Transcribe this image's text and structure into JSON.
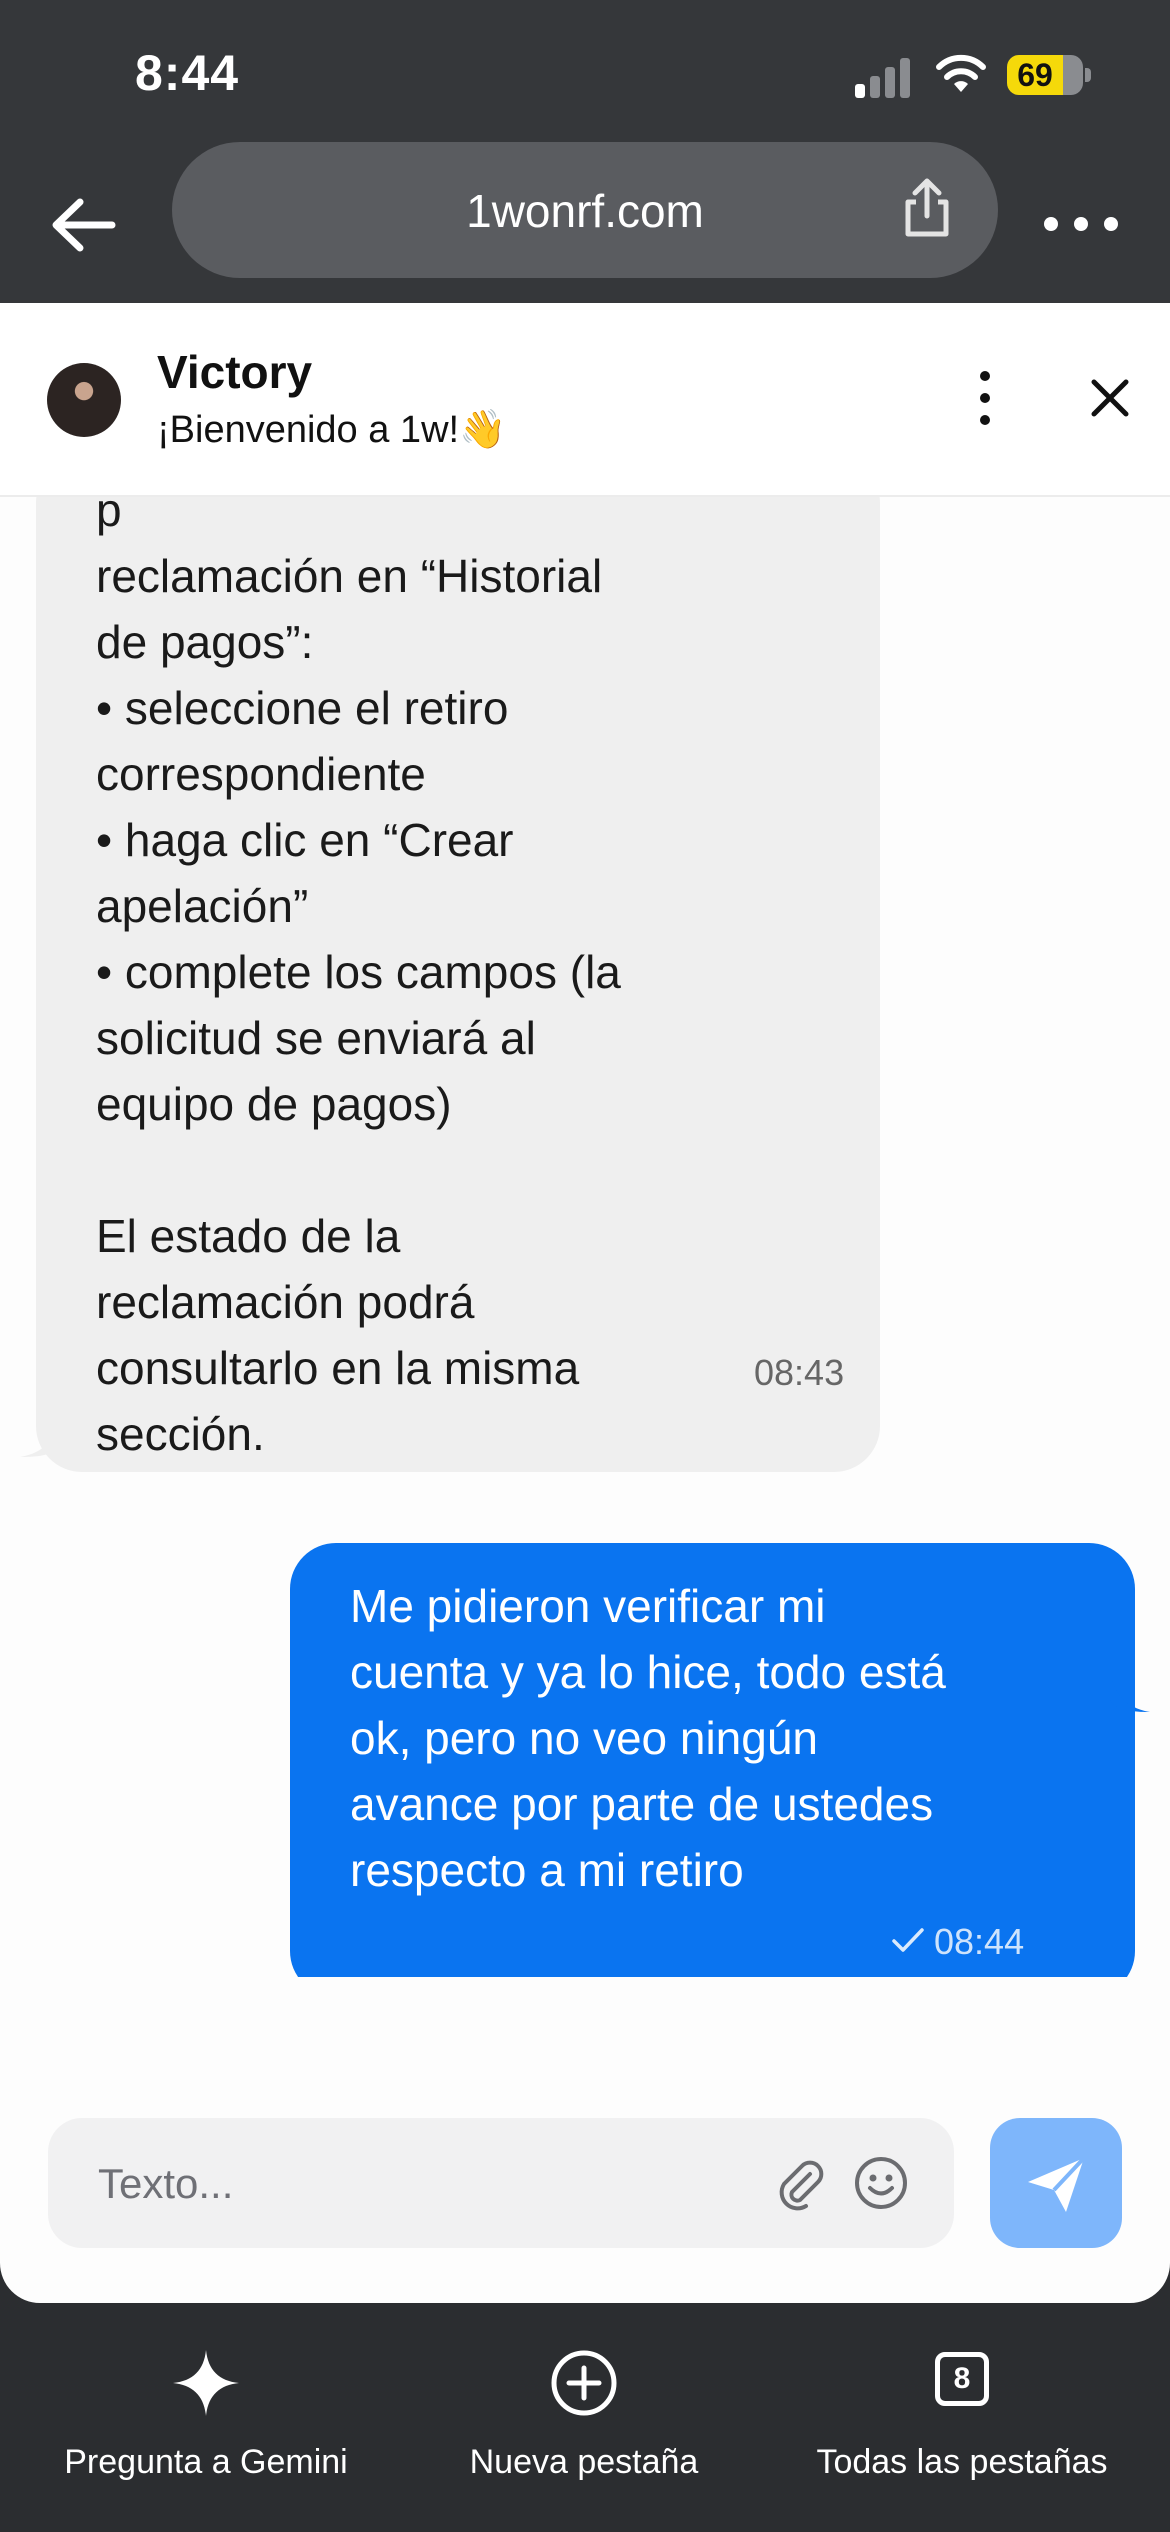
{
  "status_bar": {
    "time": "8:44",
    "battery": "69"
  },
  "browser": {
    "url": "1wonrf.com"
  },
  "chat": {
    "agent_name": "Victory",
    "agent_subtitle": "¡Bienvenido a 1w!👋",
    "incoming_message": {
      "text": "p\nreclamación en “Historial\nde pagos”:\n• seleccione el retiro\ncorrespondiente\n• haga clic en “Crear\napelación”\n• complete los campos (la\nsolicitud se enviará al\nequipo de pagos)\n\nEl estado de la\nreclamación podrá\nconsultarlo en la misma\nsección.",
      "time": "08:43"
    },
    "outgoing_message": {
      "text": "Me pidieron verificar mi cuenta y ya lo hice, todo está ok, pero no veo ningún avance por parte de ustedes respecto a mi retiro",
      "time": "08:44",
      "status": "sent"
    },
    "input": {
      "placeholder": "Texto...",
      "value": ""
    }
  },
  "bottom_nav": {
    "items": [
      {
        "label": "Pregunta a Gemini",
        "icon": "sparkle-icon"
      },
      {
        "label": "Nueva pestaña",
        "icon": "plus-circle-icon"
      },
      {
        "label": "Todas las pestañas",
        "icon": "tabs-icon",
        "count": "8"
      }
    ]
  },
  "colors": {
    "outgoing_bubble": "#0a74f0",
    "incoming_bubble": "#efefef",
    "send_button": "#7eb6fb",
    "battery": "#f5d90a"
  }
}
